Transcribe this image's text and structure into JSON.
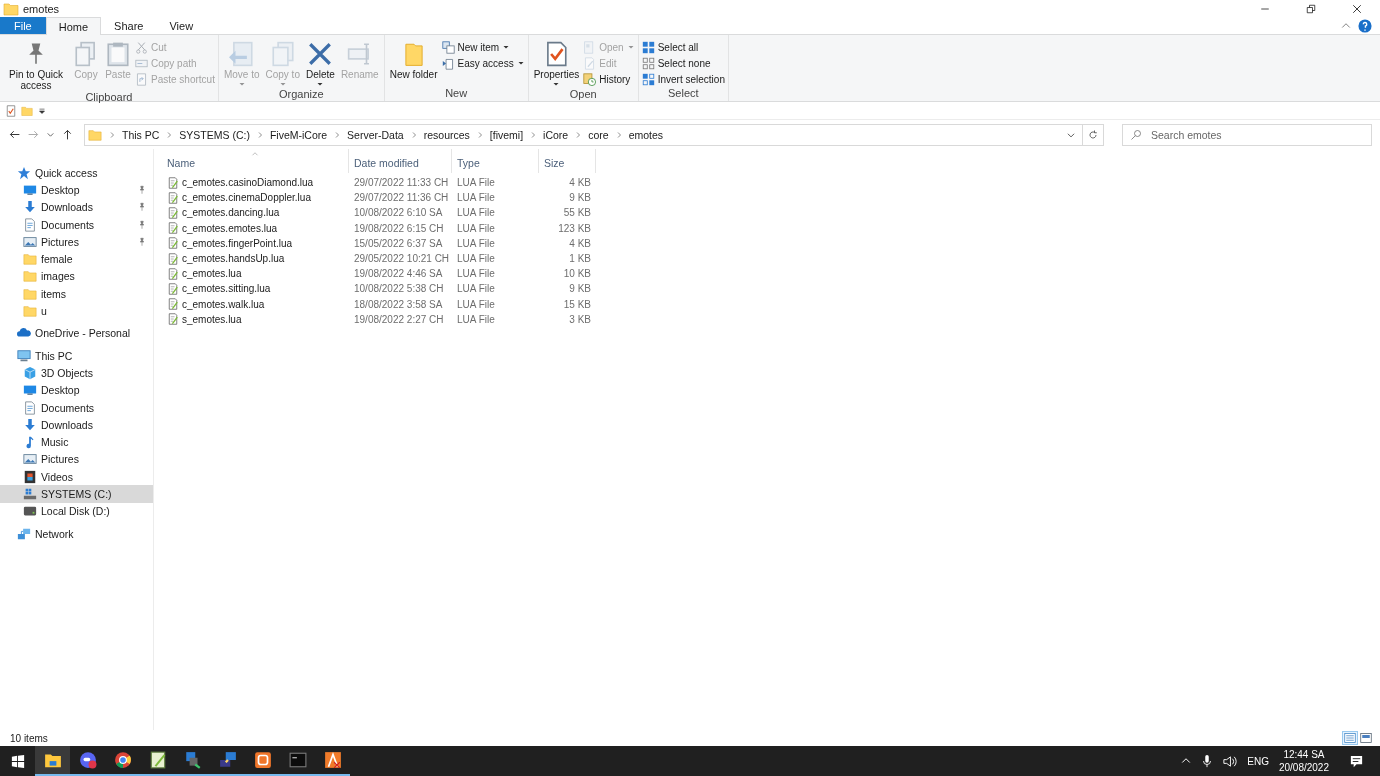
{
  "window": {
    "title": "emotes"
  },
  "ribbon": {
    "tabs": [
      {
        "label": "File",
        "kind": "file",
        "selected": false
      },
      {
        "label": "Home",
        "kind": "tab",
        "selected": true
      },
      {
        "label": "Share",
        "kind": "tab",
        "selected": false
      },
      {
        "label": "View",
        "kind": "tab",
        "selected": false
      }
    ],
    "groups": [
      {
        "label": "Clipboard",
        "commands": [
          {
            "label": "Pin to Quick access",
            "kind": "large",
            "disabled": false,
            "dropdown": false
          },
          {
            "label": "Copy",
            "kind": "large",
            "disabled": true,
            "dropdown": false
          },
          {
            "label": "Paste",
            "kind": "large",
            "disabled": true,
            "dropdown": false
          },
          {
            "label": "Cut",
            "kind": "small",
            "disabled": true,
            "dropdown": false
          },
          {
            "label": "Copy path",
            "kind": "small",
            "disabled": true,
            "dropdown": false
          },
          {
            "label": "Paste shortcut",
            "kind": "small",
            "disabled": true,
            "dropdown": false
          }
        ]
      },
      {
        "label": "Organize",
        "commands": [
          {
            "label": "Move to",
            "kind": "large",
            "disabled": true,
            "dropdown": true
          },
          {
            "label": "Copy to",
            "kind": "large",
            "disabled": true,
            "dropdown": true
          },
          {
            "label": "Delete",
            "kind": "large",
            "disabled": false,
            "dropdown": true
          },
          {
            "label": "Rename",
            "kind": "large",
            "disabled": true,
            "dropdown": false
          }
        ]
      },
      {
        "label": "New",
        "commands": [
          {
            "label": "New folder",
            "kind": "large",
            "disabled": false,
            "dropdown": false
          },
          {
            "label": "New item",
            "kind": "small",
            "disabled": false,
            "dropdown": true
          },
          {
            "label": "Easy access",
            "kind": "small",
            "disabled": false,
            "dropdown": true
          }
        ]
      },
      {
        "label": "Open",
        "commands": [
          {
            "label": "Properties",
            "kind": "large",
            "disabled": false,
            "dropdown": true
          },
          {
            "label": "Open",
            "kind": "small",
            "disabled": true,
            "dropdown": true
          },
          {
            "label": "Edit",
            "kind": "small",
            "disabled": true,
            "dropdown": false
          },
          {
            "label": "History",
            "kind": "small",
            "disabled": false,
            "dropdown": false
          }
        ]
      },
      {
        "label": "Select",
        "commands": [
          {
            "label": "Select all",
            "kind": "small",
            "disabled": false,
            "dropdown": false
          },
          {
            "label": "Select none",
            "kind": "small",
            "disabled": false,
            "dropdown": false
          },
          {
            "label": "Invert selection",
            "kind": "small",
            "disabled": false,
            "dropdown": false
          }
        ]
      }
    ]
  },
  "address": {
    "breadcrumbs": [
      "This PC",
      "SYSTEMS (C:)",
      "FiveM-iCore",
      "Server-Data",
      "resources",
      "[fivemi]",
      "iCore",
      "core",
      "emotes"
    ]
  },
  "search": {
    "placeholder": "Search emotes"
  },
  "sidebar": {
    "items": [
      {
        "label": "Quick access",
        "selected": false,
        "children": [
          {
            "label": "Desktop",
            "selected": false,
            "pinned": true
          },
          {
            "label": "Downloads",
            "selected": false,
            "pinned": true
          },
          {
            "label": "Documents",
            "selected": false,
            "pinned": true
          },
          {
            "label": "Pictures",
            "selected": false,
            "pinned": true
          },
          {
            "label": "female",
            "selected": false,
            "pinned": false
          },
          {
            "label": "images",
            "selected": false,
            "pinned": false
          },
          {
            "label": "items",
            "selected": false,
            "pinned": false
          },
          {
            "label": "u",
            "selected": false,
            "pinned": false
          }
        ]
      },
      {
        "label": "OneDrive - Personal",
        "selected": false
      },
      {
        "label": "This PC",
        "selected": false,
        "children": [
          {
            "label": "3D Objects",
            "selected": false
          },
          {
            "label": "Desktop",
            "selected": false
          },
          {
            "label": "Documents",
            "selected": false
          },
          {
            "label": "Downloads",
            "selected": false
          },
          {
            "label": "Music",
            "selected": false
          },
          {
            "label": "Pictures",
            "selected": false
          },
          {
            "label": "Videos",
            "selected": false
          },
          {
            "label": "SYSTEMS (C:)",
            "selected": true
          },
          {
            "label": "Local Disk (D:)",
            "selected": false
          }
        ]
      },
      {
        "label": "Network",
        "selected": false
      }
    ]
  },
  "table": {
    "columns": [
      {
        "label": "Name",
        "sorted": true
      },
      {
        "label": "Date modified",
        "sorted": false
      },
      {
        "label": "Type",
        "sorted": false
      },
      {
        "label": "Size",
        "sorted": false
      }
    ],
    "rows": [
      {
        "name": "c_emotes.casinoDiamond.lua",
        "date": "29/07/2022 11:33 CH",
        "type": "LUA File",
        "size": "4 KB"
      },
      {
        "name": "c_emotes.cinemaDoppler.lua",
        "date": "29/07/2022 11:36 CH",
        "type": "LUA File",
        "size": "9 KB"
      },
      {
        "name": "c_emotes.dancing.lua",
        "date": "10/08/2022 6:10 SA",
        "type": "LUA File",
        "size": "55 KB"
      },
      {
        "name": "c_emotes.emotes.lua",
        "date": "19/08/2022 6:15 CH",
        "type": "LUA File",
        "size": "123 KB"
      },
      {
        "name": "c_emotes.fingerPoint.lua",
        "date": "15/05/2022 6:37 SA",
        "type": "LUA File",
        "size": "4 KB"
      },
      {
        "name": "c_emotes.handsUp.lua",
        "date": "29/05/2022 10:21 CH",
        "type": "LUA File",
        "size": "1 KB"
      },
      {
        "name": "c_emotes.lua",
        "date": "19/08/2022 4:46 SA",
        "type": "LUA File",
        "size": "10 KB"
      },
      {
        "name": "c_emotes.sitting.lua",
        "date": "10/08/2022 5:38 CH",
        "type": "LUA File",
        "size": "9 KB"
      },
      {
        "name": "c_emotes.walk.lua",
        "date": "18/08/2022 3:58 SA",
        "type": "LUA File",
        "size": "15 KB"
      },
      {
        "name": "s_emotes.lua",
        "date": "19/08/2022 2:27 CH",
        "type": "LUA File",
        "size": "3 KB"
      }
    ]
  },
  "status_bar": {
    "count": "10 items",
    "views": [
      {
        "selected": true
      },
      {
        "selected": false
      }
    ]
  },
  "taskbar": {
    "apps": [
      {
        "active": true
      },
      {
        "active": false
      },
      {
        "active": false
      },
      {
        "active": false
      },
      {
        "active": false
      },
      {
        "active": false
      },
      {
        "active": false
      },
      {
        "active": false
      },
      {
        "active": false
      }
    ],
    "language": "ENG",
    "time": "12:44 SA",
    "date": "20/08/2022"
  }
}
